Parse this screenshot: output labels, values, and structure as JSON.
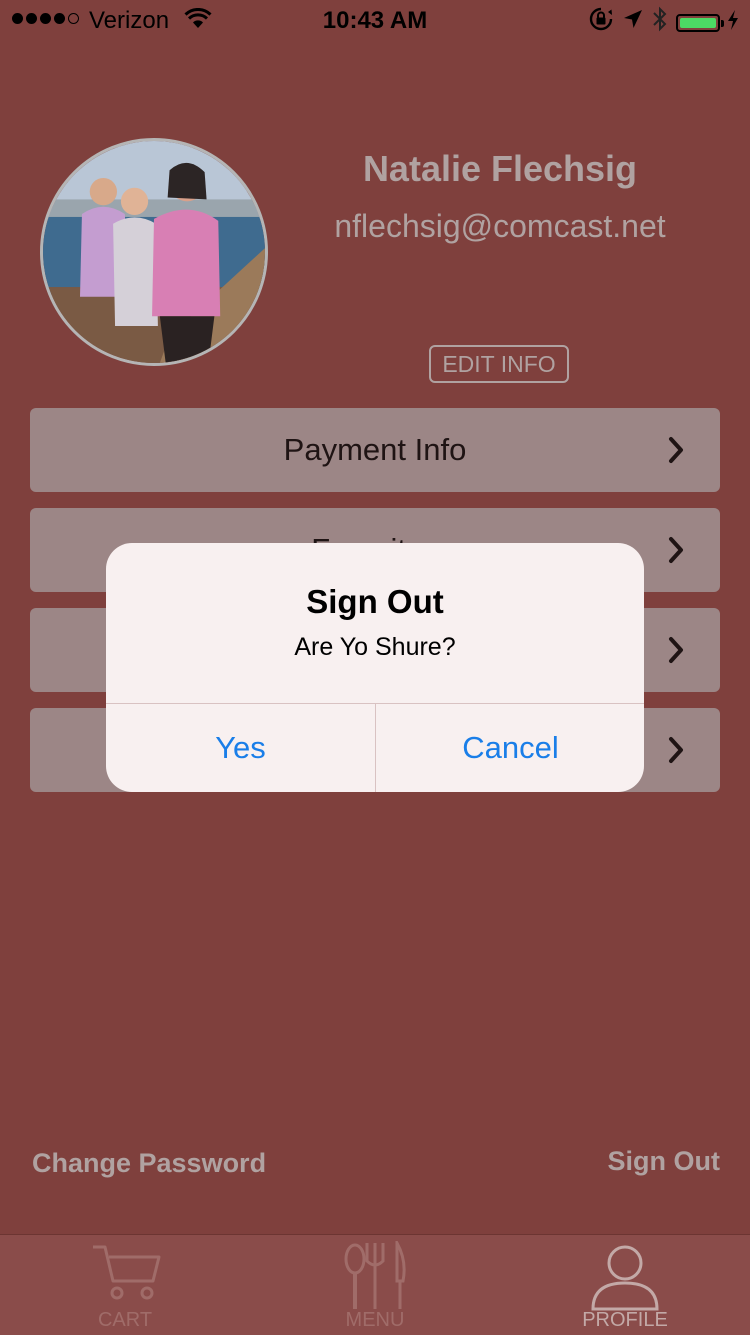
{
  "status_bar": {
    "carrier": "Verizon",
    "time": "10:43 AM",
    "signal_bars": 4,
    "signal_total": 5,
    "battery_level": 1.0
  },
  "profile": {
    "name": "Natalie Flechsig",
    "email": "nflechsig@comcast.net",
    "edit_label": "EDIT INFO"
  },
  "menu": {
    "items": [
      {
        "label": "Payment Info"
      },
      {
        "label": "Favorites"
      },
      {
        "label": ""
      },
      {
        "label": ""
      }
    ]
  },
  "footer_links": {
    "change_password": "Change Password",
    "sign_out": "Sign Out"
  },
  "tab_bar": {
    "tabs": [
      {
        "label": "CART",
        "icon": "cart-icon"
      },
      {
        "label": "MENU",
        "icon": "fork-knife-icon"
      },
      {
        "label": "PROFILE",
        "icon": "person-icon"
      }
    ],
    "active": "PROFILE"
  },
  "alert": {
    "title": "Sign Out",
    "message": "Are Yo Shure?",
    "confirm_label": "Yes",
    "cancel_label": "Cancel"
  },
  "colors": {
    "background_overlay": "#7f403d",
    "alert_button": "#1a7ee8",
    "battery": "#4cd964"
  }
}
